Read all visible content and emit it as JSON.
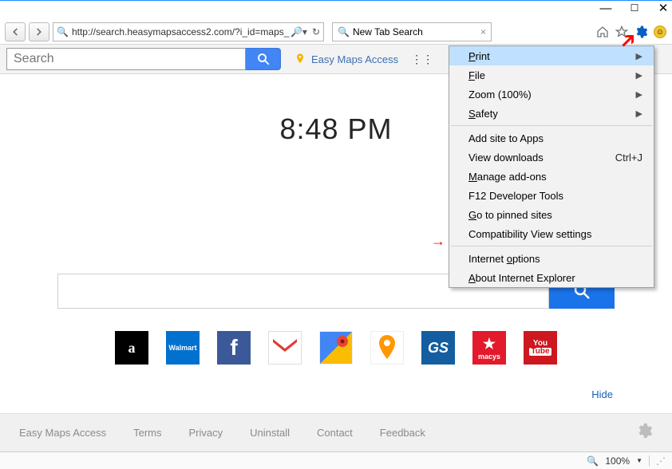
{
  "window": {
    "url": "http://search.heasymapsaccess2.com/?i_id=maps_",
    "tab_title": "New Tab Search"
  },
  "toolbar": {
    "search_placeholder": "Search",
    "link_label": "Easy Maps Access"
  },
  "clock": "8:48 PM",
  "hide": "Hide",
  "menu": {
    "print": "Print",
    "file": "File",
    "zoom": "Zoom (100%)",
    "safety": "Safety",
    "add_site": "Add site to Apps",
    "view_dl": "View downloads",
    "view_dl_shortcut": "Ctrl+J",
    "manage": "Manage add-ons",
    "f12": "F12 Developer Tools",
    "pinned": "Go to pinned sites",
    "compat": "Compatibility View settings",
    "options": "Internet options",
    "about": "About Internet Explorer"
  },
  "footer": {
    "brand": "Easy Maps Access",
    "terms": "Terms",
    "privacy": "Privacy",
    "uninstall": "Uninstall",
    "contact": "Contact",
    "feedback": "Feedback"
  },
  "status": {
    "zoom": "100%"
  },
  "shortcuts": {
    "amazon": "a",
    "walmart": "Walmart",
    "fb": "f",
    "gs": "GS",
    "macys": "macys",
    "yt_top": "You",
    "yt_bot": "Tube"
  }
}
